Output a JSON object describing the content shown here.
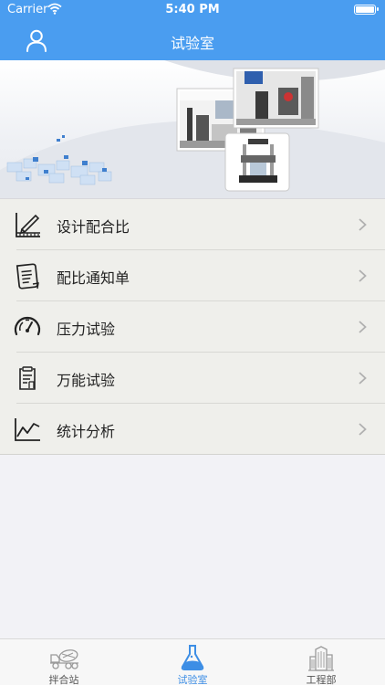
{
  "status_bar": {
    "carrier": "Carrier",
    "time": "5:40 PM"
  },
  "nav": {
    "title": "试验室",
    "user_icon": "user-icon"
  },
  "menu": [
    {
      "label": "设计配合比",
      "icon": "design-ruler-icon"
    },
    {
      "label": "配比通知单",
      "icon": "notice-document-icon"
    },
    {
      "label": "压力试验",
      "icon": "pressure-gauge-icon"
    },
    {
      "label": "万能试验",
      "icon": "universal-test-icon"
    },
    {
      "label": "统计分析",
      "icon": "line-chart-icon"
    }
  ],
  "tabs": [
    {
      "label": "拌合站",
      "icon": "mixer-truck-icon",
      "active": false
    },
    {
      "label": "试验室",
      "icon": "lab-flask-icon",
      "active": true
    },
    {
      "label": "工程部",
      "icon": "building-icon",
      "active": false
    }
  ],
  "colors": {
    "accent": "#4a9df0",
    "tab_active": "#3d8ee5"
  }
}
